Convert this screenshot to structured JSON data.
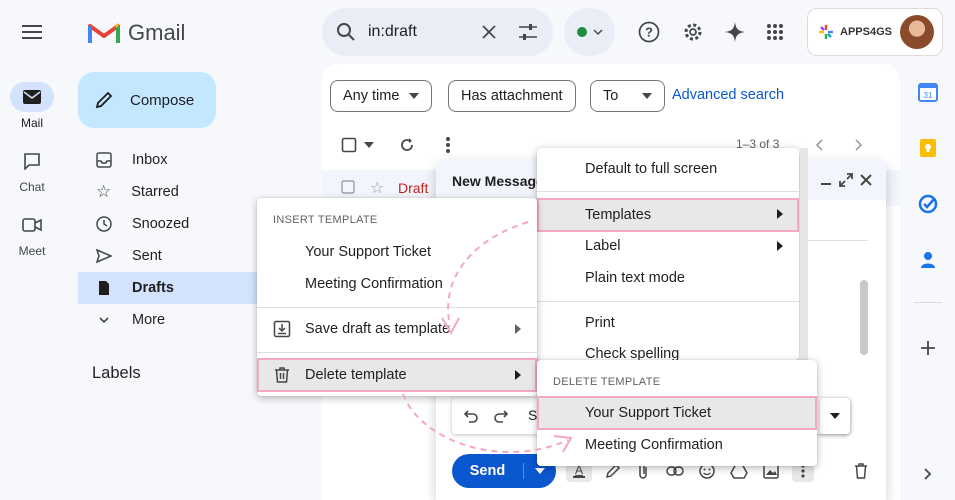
{
  "app": {
    "name": "Gmail"
  },
  "rail": [
    {
      "label": "Mail"
    },
    {
      "label": "Chat"
    },
    {
      "label": "Meet"
    }
  ],
  "compose_label": "Compose",
  "nav": [
    "Inbox",
    "Starred",
    "Snoozed",
    "Sent",
    "Drafts",
    "More"
  ],
  "labels_heading": "Labels",
  "search": {
    "value": "in:draft"
  },
  "account": {
    "name": "APPS4GS"
  },
  "filters": {
    "time": "Any time",
    "attachment": "Has attachment",
    "to": "To",
    "advanced": "Advanced search"
  },
  "list": {
    "count": "1–3 of 3",
    "row_label": "Draft"
  },
  "compose_window": {
    "title": "New Message",
    "send": "Send",
    "fmt_text": "S"
  },
  "more_menu": [
    "Default to full screen",
    "Templates",
    "Label",
    "Plain text mode",
    "Print",
    "Check spelling"
  ],
  "insert_menu": {
    "header": "INSERT TEMPLATE",
    "items": [
      "Your Support Ticket",
      "Meeting Confirmation"
    ],
    "save": "Save draft as template",
    "delete": "Delete template"
  },
  "delete_menu": {
    "header": "DELETE TEMPLATE",
    "items": [
      "Your Support Ticket",
      "Meeting Confirmation"
    ]
  },
  "colors": {
    "accent": "#0b57d0",
    "highlight": "#f3a9c0",
    "draft_red": "#c5221f"
  }
}
